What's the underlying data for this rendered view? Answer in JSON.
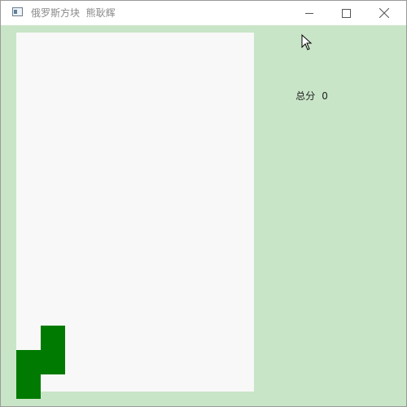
{
  "window": {
    "title": "俄罗斯方块  熊耿辉"
  },
  "controls": {
    "minimize": "minimize-icon",
    "maximize": "maximize-icon",
    "close": "close-icon"
  },
  "sidebar": {
    "score_label": "总分",
    "score_value": "0"
  },
  "colors": {
    "background": "#c9e5c7",
    "board": "#f8f8f8",
    "piece": "#007a00"
  },
  "game": {
    "piece": "S",
    "occupied_cells": [
      {
        "col": 1,
        "row": 12
      },
      {
        "col": 0,
        "row": 13
      },
      {
        "col": 1,
        "row": 13
      },
      {
        "col": 0,
        "row": 14
      }
    ]
  }
}
